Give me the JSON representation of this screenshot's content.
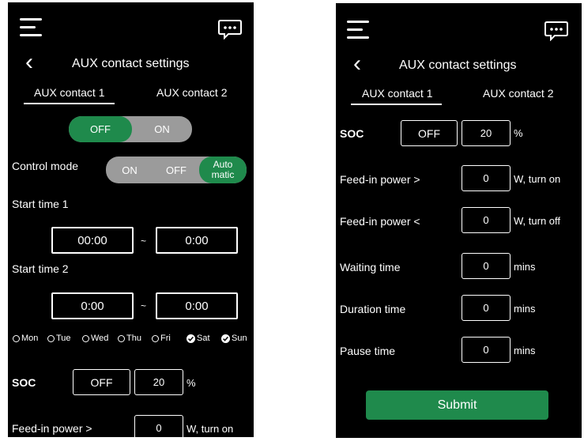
{
  "left": {
    "header": {
      "menu_icon": "hamburger-icon",
      "chat_icon": "chat-icon",
      "back_icon": "back-chevron-icon",
      "back_glyph": "‹",
      "title": "AUX contact settings"
    },
    "tabs": [
      "AUX contact 1",
      "AUX contact 2"
    ],
    "power_toggle": {
      "off": "OFF",
      "on": "ON",
      "selected": "OFF"
    },
    "control_mode": {
      "label": "Control mode",
      "options": [
        "ON",
        "OFF",
        "Automatic"
      ],
      "auto_line1": "Auto",
      "auto_line2": "matic",
      "selected": "Automatic"
    },
    "start_time_1": {
      "label": "Start time 1",
      "from": "00:00",
      "sep": "~",
      "to": "0:00"
    },
    "start_time_2": {
      "label": "Start time 2",
      "from": "0:00",
      "sep": "~",
      "to": "0:00"
    },
    "days": [
      {
        "label": "Mon",
        "checked": false
      },
      {
        "label": "Tue",
        "checked": false
      },
      {
        "label": "Wed",
        "checked": false
      },
      {
        "label": "Thu",
        "checked": false
      },
      {
        "label": "Fri",
        "checked": false
      },
      {
        "label": "Sat",
        "checked": true
      },
      {
        "label": "Sun",
        "checked": true
      }
    ],
    "soc": {
      "label": "SOC",
      "toggle": "OFF",
      "value": "20",
      "unit": "%"
    },
    "feed_in_gt": {
      "label": "Feed-in power >",
      "value": "0",
      "unit": "W, turn on"
    }
  },
  "right": {
    "header": {
      "menu_icon": "hamburger-icon",
      "chat_icon": "chat-icon",
      "back_icon": "back-chevron-icon",
      "back_glyph": "‹",
      "title": "AUX contact settings"
    },
    "tabs": [
      "AUX contact 1",
      "AUX contact 2"
    ],
    "soc": {
      "label": "SOC",
      "toggle": "OFF",
      "value": "20",
      "unit": "%"
    },
    "feed_in_gt": {
      "label": "Feed-in power >",
      "value": "0",
      "unit": "W, turn on"
    },
    "feed_in_lt": {
      "label": "Feed-in power <",
      "value": "0",
      "unit": "W, turn off"
    },
    "waiting_time": {
      "label": "Waiting  time",
      "value": "0",
      "unit": "mins"
    },
    "duration_time": {
      "label": "Duration time",
      "value": "0",
      "unit": "mins"
    },
    "pause_time": {
      "label": "Pause time",
      "value": "0",
      "unit": "mins"
    },
    "submit": "Submit"
  },
  "colors": {
    "accent": "#1f8a4c",
    "toggle_bg": "#9b9b9b",
    "screen_bg": "#000000"
  }
}
